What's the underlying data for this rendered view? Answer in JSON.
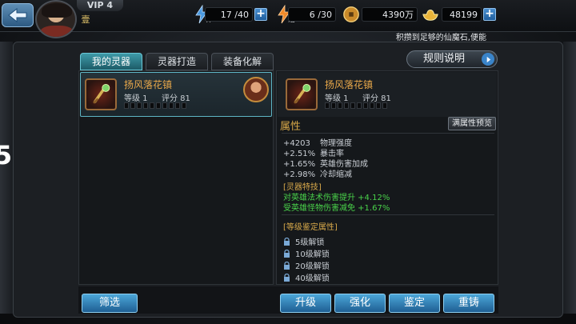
{
  "vip": "VIP 4",
  "rank_char": "壹",
  "resources": {
    "stamina": {
      "icon_label": "体",
      "value": "17 /40"
    },
    "energy": {
      "icon_label": "活",
      "value": "6 /30"
    },
    "coins": {
      "value": "4390万"
    },
    "gold": {
      "value": "48199"
    }
  },
  "notice": "积攒到足够的仙魔石,便能",
  "side_number": "5",
  "tabs": [
    {
      "label": "我的灵器",
      "active": true
    },
    {
      "label": "灵器打造",
      "active": false
    },
    {
      "label": "装备化解",
      "active": false
    }
  ],
  "rules_label": "规则说明",
  "item": {
    "name": "扬风落花镇",
    "level": "等级 1",
    "score": "评分 81"
  },
  "attributes": {
    "title": "属性",
    "preview_label": "满属性预览",
    "lines": [
      {
        "value": "+4203",
        "name": "物理强度"
      },
      {
        "value": "+2.51%",
        "name": "暴击率"
      },
      {
        "value": "+1.65%",
        "name": "英雄伤害加成"
      },
      {
        "value": "+2.98%",
        "name": "冷却缩减"
      }
    ]
  },
  "skill": {
    "title": "[灵器特技]",
    "lines": [
      "对英雄法术伤害提升 +4.12%",
      "受英雄怪物伤害减免 +1.67%"
    ]
  },
  "identify": {
    "title": "[等级鉴定属性]",
    "locks": [
      "5级解锁",
      "10级解锁",
      "20级解锁",
      "40级解锁"
    ]
  },
  "buttons": {
    "filter": "筛选",
    "upgrade": "升级",
    "enhance": "强化",
    "identify": "鉴定",
    "recast": "重铸"
  },
  "colors": {
    "accent": "#4ba6d8",
    "item_name": "#e8a84a",
    "skill": "#49d24a",
    "section": "#d7a84a"
  }
}
